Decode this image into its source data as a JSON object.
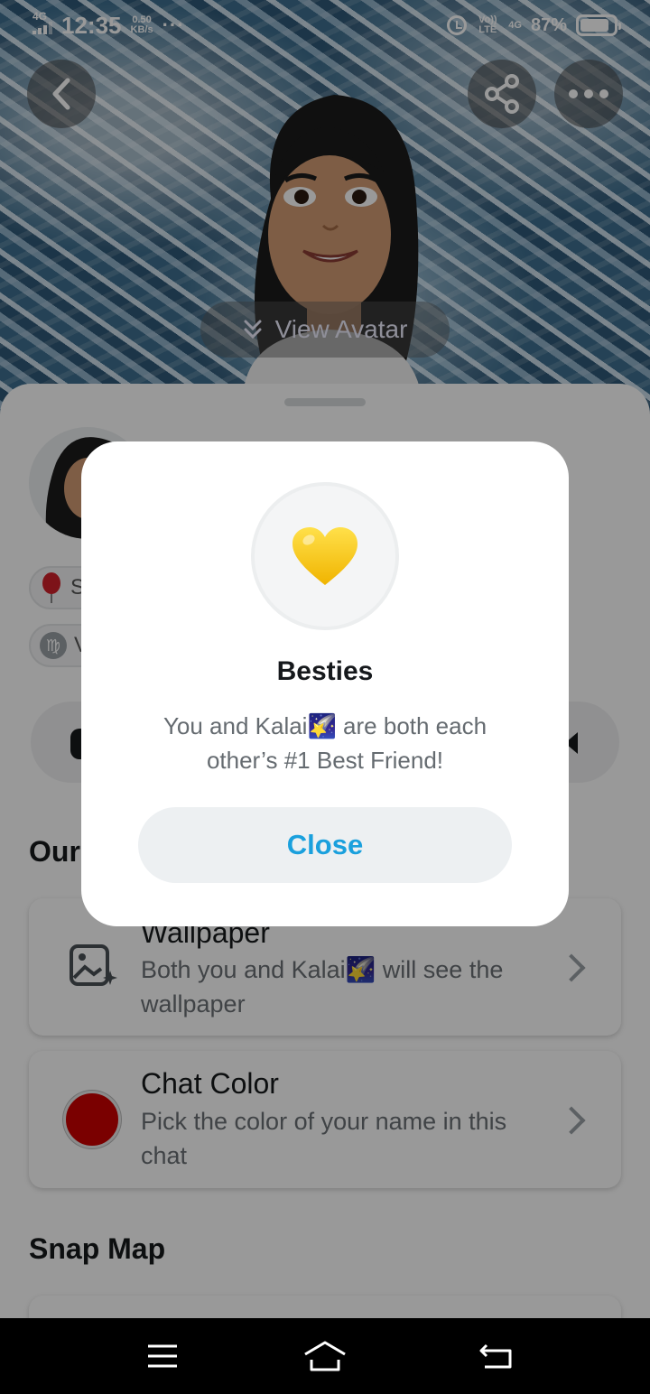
{
  "status_bar": {
    "network": "4G",
    "time": "12:35",
    "speed_value": "0.50",
    "speed_unit": "KB/s",
    "more_dots": "···",
    "volte": "Vo)) LTE",
    "network2": "4G",
    "battery": "87%",
    "battery_level": 0.87
  },
  "header": {
    "view_avatar_label": "View Avatar"
  },
  "chips": [
    {
      "icon": "balloon-icon",
      "text": "S"
    },
    {
      "icon": "virgo-icon",
      "text": "V"
    }
  ],
  "sections": {
    "ours_title": "Our",
    "snap_map_title": "Snap Map"
  },
  "cards": [
    {
      "title": "Wallpaper",
      "desc": "Both you and Kalai🌠 will see the wallpaper",
      "icon": "wallpaper-icon"
    },
    {
      "title": "Chat Color",
      "desc": "Pick the color of your name in this chat",
      "icon": "color-swatch",
      "color": "#cc0000"
    }
  ],
  "modal": {
    "icon": "yellow-heart",
    "title": "Besties",
    "text": "You and Kalai🌠 are both each other’s #1 Best Friend!",
    "close_label": "Close"
  },
  "colors": {
    "accent": "#1aa0dd",
    "heart": "#f5c400",
    "chat_color": "#cc0000"
  }
}
